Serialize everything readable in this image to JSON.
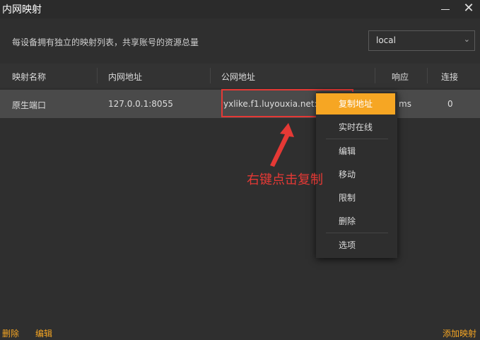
{
  "window": {
    "title": "内网映射",
    "minimize_glyph": "—",
    "close_glyph": "✕"
  },
  "description": "每设备拥有独立的映射列表，共享账号的资源总量",
  "device_select": {
    "value": "local",
    "icon": "chevron-down-icon"
  },
  "table": {
    "headers": [
      "映射名称",
      "内网地址",
      "公网地址",
      "响应",
      "连接"
    ],
    "rows": [
      {
        "name": "原生端口",
        "local_addr": "127.0.0.1:8055",
        "public_addr": "yxlike.f1.luyouxia.net:1",
        "latency": "ms",
        "connections": "0"
      }
    ]
  },
  "context_menu": {
    "items": [
      "复制地址",
      "实时在线",
      "编辑",
      "移动",
      "限制",
      "删除",
      "选项"
    ]
  },
  "annotation": {
    "text": "右键点击复制",
    "color": "#e53935"
  },
  "footer": {
    "delete": "删除",
    "edit": "编辑",
    "add": "添加映射"
  },
  "colors": {
    "accent": "#f6a623",
    "highlight": "#e53935",
    "background": "#2f2f2f"
  }
}
